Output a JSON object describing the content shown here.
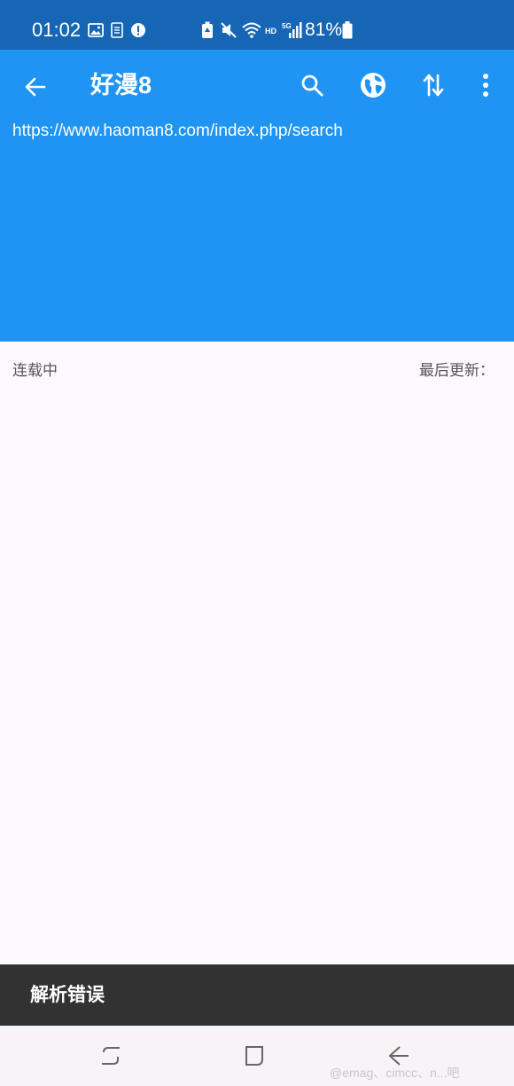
{
  "status_bar": {
    "time": "01:02",
    "battery_percent": "81%",
    "left_icons": [
      "image-icon",
      "document-icon",
      "alert-icon"
    ],
    "right_icons": [
      "battery-saver-icon",
      "mute-icon",
      "wifi-icon",
      "hd-5g-signal-icon",
      "battery-icon"
    ]
  },
  "app_bar": {
    "title": "好漫8",
    "url": "https://www.haoman8.com/index.php/search",
    "color": "#2094f3",
    "actions": [
      "search-icon",
      "globe-icon",
      "sort-icon",
      "more-vertical-icon"
    ]
  },
  "info_row": {
    "status": "连载中",
    "last_update_label": "最后更新："
  },
  "snackbar": {
    "message": "解析错误"
  },
  "nav_bar": {
    "buttons": [
      "recents-icon",
      "home-icon",
      "back-icon"
    ],
    "watermark": "@emag、cimcc、n...吧"
  }
}
